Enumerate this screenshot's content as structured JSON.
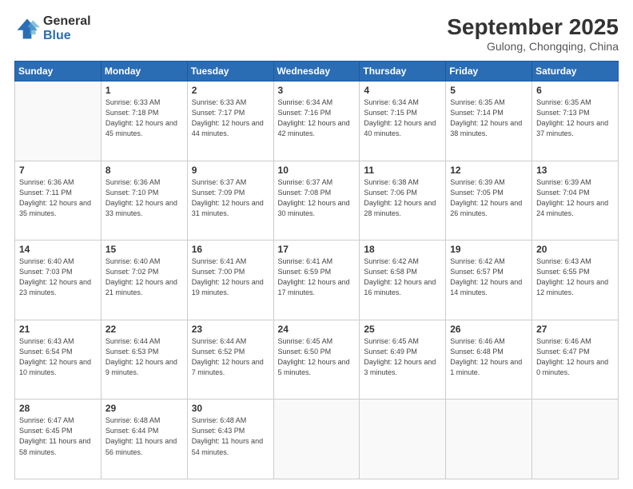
{
  "header": {
    "logo_general": "General",
    "logo_blue": "Blue",
    "month": "September 2025",
    "location": "Gulong, Chongqing, China"
  },
  "weekdays": [
    "Sunday",
    "Monday",
    "Tuesday",
    "Wednesday",
    "Thursday",
    "Friday",
    "Saturday"
  ],
  "weeks": [
    [
      {
        "day": "",
        "info": ""
      },
      {
        "day": "1",
        "info": "Sunrise: 6:33 AM\nSunset: 7:18 PM\nDaylight: 12 hours\nand 45 minutes."
      },
      {
        "day": "2",
        "info": "Sunrise: 6:33 AM\nSunset: 7:17 PM\nDaylight: 12 hours\nand 44 minutes."
      },
      {
        "day": "3",
        "info": "Sunrise: 6:34 AM\nSunset: 7:16 PM\nDaylight: 12 hours\nand 42 minutes."
      },
      {
        "day": "4",
        "info": "Sunrise: 6:34 AM\nSunset: 7:15 PM\nDaylight: 12 hours\nand 40 minutes."
      },
      {
        "day": "5",
        "info": "Sunrise: 6:35 AM\nSunset: 7:14 PM\nDaylight: 12 hours\nand 38 minutes."
      },
      {
        "day": "6",
        "info": "Sunrise: 6:35 AM\nSunset: 7:13 PM\nDaylight: 12 hours\nand 37 minutes."
      }
    ],
    [
      {
        "day": "7",
        "info": "Sunrise: 6:36 AM\nSunset: 7:11 PM\nDaylight: 12 hours\nand 35 minutes."
      },
      {
        "day": "8",
        "info": "Sunrise: 6:36 AM\nSunset: 7:10 PM\nDaylight: 12 hours\nand 33 minutes."
      },
      {
        "day": "9",
        "info": "Sunrise: 6:37 AM\nSunset: 7:09 PM\nDaylight: 12 hours\nand 31 minutes."
      },
      {
        "day": "10",
        "info": "Sunrise: 6:37 AM\nSunset: 7:08 PM\nDaylight: 12 hours\nand 30 minutes."
      },
      {
        "day": "11",
        "info": "Sunrise: 6:38 AM\nSunset: 7:06 PM\nDaylight: 12 hours\nand 28 minutes."
      },
      {
        "day": "12",
        "info": "Sunrise: 6:39 AM\nSunset: 7:05 PM\nDaylight: 12 hours\nand 26 minutes."
      },
      {
        "day": "13",
        "info": "Sunrise: 6:39 AM\nSunset: 7:04 PM\nDaylight: 12 hours\nand 24 minutes."
      }
    ],
    [
      {
        "day": "14",
        "info": "Sunrise: 6:40 AM\nSunset: 7:03 PM\nDaylight: 12 hours\nand 23 minutes."
      },
      {
        "day": "15",
        "info": "Sunrise: 6:40 AM\nSunset: 7:02 PM\nDaylight: 12 hours\nand 21 minutes."
      },
      {
        "day": "16",
        "info": "Sunrise: 6:41 AM\nSunset: 7:00 PM\nDaylight: 12 hours\nand 19 minutes."
      },
      {
        "day": "17",
        "info": "Sunrise: 6:41 AM\nSunset: 6:59 PM\nDaylight: 12 hours\nand 17 minutes."
      },
      {
        "day": "18",
        "info": "Sunrise: 6:42 AM\nSunset: 6:58 PM\nDaylight: 12 hours\nand 16 minutes."
      },
      {
        "day": "19",
        "info": "Sunrise: 6:42 AM\nSunset: 6:57 PM\nDaylight: 12 hours\nand 14 minutes."
      },
      {
        "day": "20",
        "info": "Sunrise: 6:43 AM\nSunset: 6:55 PM\nDaylight: 12 hours\nand 12 minutes."
      }
    ],
    [
      {
        "day": "21",
        "info": "Sunrise: 6:43 AM\nSunset: 6:54 PM\nDaylight: 12 hours\nand 10 minutes."
      },
      {
        "day": "22",
        "info": "Sunrise: 6:44 AM\nSunset: 6:53 PM\nDaylight: 12 hours\nand 9 minutes."
      },
      {
        "day": "23",
        "info": "Sunrise: 6:44 AM\nSunset: 6:52 PM\nDaylight: 12 hours\nand 7 minutes."
      },
      {
        "day": "24",
        "info": "Sunrise: 6:45 AM\nSunset: 6:50 PM\nDaylight: 12 hours\nand 5 minutes."
      },
      {
        "day": "25",
        "info": "Sunrise: 6:45 AM\nSunset: 6:49 PM\nDaylight: 12 hours\nand 3 minutes."
      },
      {
        "day": "26",
        "info": "Sunrise: 6:46 AM\nSunset: 6:48 PM\nDaylight: 12 hours\nand 1 minute."
      },
      {
        "day": "27",
        "info": "Sunrise: 6:46 AM\nSunset: 6:47 PM\nDaylight: 12 hours\nand 0 minutes."
      }
    ],
    [
      {
        "day": "28",
        "info": "Sunrise: 6:47 AM\nSunset: 6:45 PM\nDaylight: 11 hours\nand 58 minutes."
      },
      {
        "day": "29",
        "info": "Sunrise: 6:48 AM\nSunset: 6:44 PM\nDaylight: 11 hours\nand 56 minutes."
      },
      {
        "day": "30",
        "info": "Sunrise: 6:48 AM\nSunset: 6:43 PM\nDaylight: 11 hours\nand 54 minutes."
      },
      {
        "day": "",
        "info": ""
      },
      {
        "day": "",
        "info": ""
      },
      {
        "day": "",
        "info": ""
      },
      {
        "day": "",
        "info": ""
      }
    ]
  ]
}
